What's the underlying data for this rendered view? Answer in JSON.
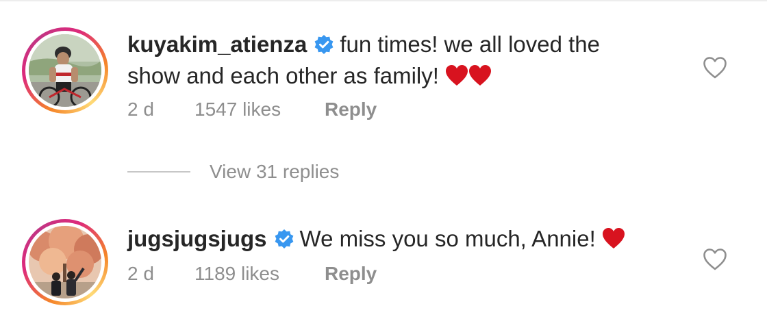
{
  "comments": [
    {
      "username": "kuyakim_atienza",
      "verified": true,
      "text_line1": "fun times! we all loved the",
      "text_line2": "show and each other as family!",
      "emoji": [
        "red-heart",
        "red-heart"
      ],
      "time": "2 d",
      "likes": "1547 likes",
      "reply_label": "Reply",
      "avatar": "cyclist-photo"
    },
    {
      "username": "jugsjugsjugs",
      "verified": true,
      "text": "We miss you so much, Annie!",
      "emoji": [
        "red-heart"
      ],
      "time": "2 d",
      "likes": "1189 likes",
      "reply_label": "Reply",
      "avatar": "autumn-tree-photo"
    }
  ],
  "replies_toggle": {
    "label": "View 31 replies"
  },
  "icons": {
    "verified": "verified-badge-icon",
    "like": "heart-outline-icon",
    "emoji": "red-heart-emoji"
  },
  "colors": {
    "text": "#262626",
    "secondary": "#8e8e8e",
    "verified_blue": "#3897f0",
    "heart_red": "#d8131f",
    "divider": "#c7c7c7"
  }
}
